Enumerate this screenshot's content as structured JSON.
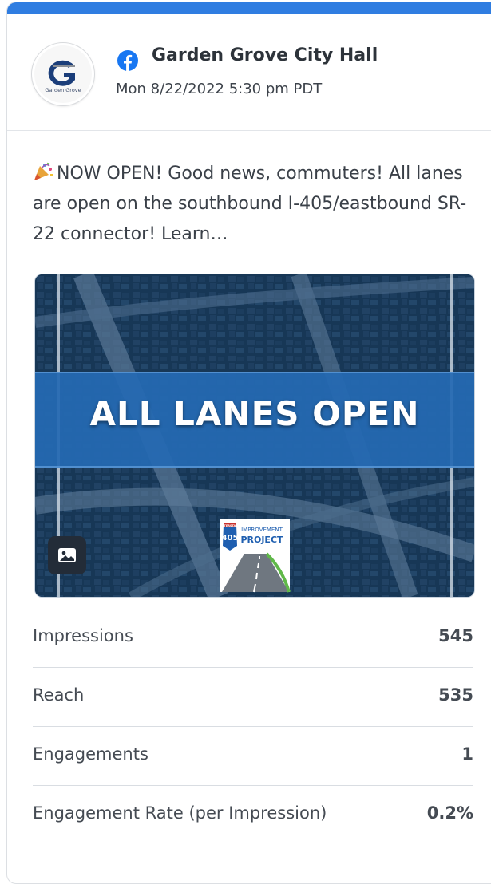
{
  "post": {
    "page_name": "Garden Grove City Hall",
    "timestamp": "Mon 8/22/2022 5:30 pm PDT",
    "network_icon": "facebook-icon",
    "avatar_text": "Garden Grove",
    "text": "NOW OPEN! Good news, commuters! All lanes are open on the southbound I-405/eastbound SR-22 connector! Learn…",
    "emoji": "party-popper-icon"
  },
  "media": {
    "banner": "ALL LANES OPEN",
    "badge_top": "INTERSTATE",
    "badge_number": "405",
    "badge_line1": "IMPROVEMENT",
    "badge_line2": "PROJECT",
    "type_icon": "image-icon"
  },
  "metrics": [
    {
      "label": "Impressions",
      "value": "545"
    },
    {
      "label": "Reach",
      "value": "535"
    },
    {
      "label": "Engagements",
      "value": "1"
    },
    {
      "label": "Engagement Rate (per Impression)",
      "value": "0.2%"
    }
  ],
  "colors": {
    "accent": "#2f7de1",
    "facebook": "#1877f2",
    "banner": "#2569b3",
    "card_border": "#dcdfe3"
  }
}
